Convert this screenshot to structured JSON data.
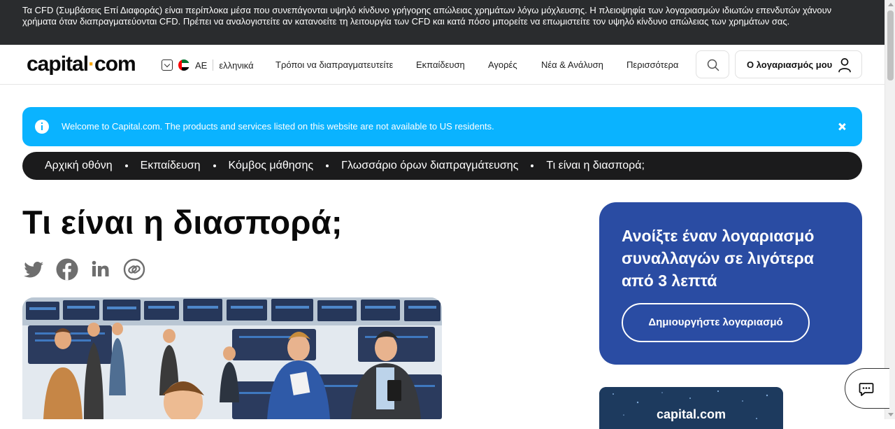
{
  "risk_warning": "Τα CFD (Συμβάσεις Επί Διαφοράς) είναι περίπλοκα μέσα που συνεπάγονται υψηλό κίνδυνο γρήγορης απώλειας χρημάτων λόγω μόχλευσης. Η πλειοψηφία των λογαριασμών ιδιωτών επενδυτών χάνουν χρήματα όταν διαπραγματεύονται CFD. Πρέπει να αναλογιστείτε αν κατανοείτε τη λειτουργία των CFD και κατά πόσο μπορείτε να επωμιστείτε τον υψηλό κίνδυνο απώλειας των χρημάτων σας.",
  "header": {
    "logo_left": "capital",
    "logo_right": "com",
    "region_code": "AE",
    "language": "ελληνικά",
    "nav": [
      "Τρόποι να διαπραγματευτείτε",
      "Εκπαίδευση",
      "Αγορές",
      "Νέα & Ανάλυση",
      "Περισσότερα"
    ],
    "account_label": "Ο λογαριασμός μου"
  },
  "welcome": {
    "message": "Welcome to Capital.com. The products and services listed on this website are not available to US residents."
  },
  "breadcrumb": [
    "Αρχική οθόνη",
    "Εκπαίδευση",
    "Κόμβος μάθησης",
    "Γλωσσάριο όρων διαπραγμάτευσης",
    "Τι είναι η διασπορά;"
  ],
  "article": {
    "title": "Τι είναι η διασπορά;",
    "share_icons": [
      "twitter-icon",
      "facebook-icon",
      "linkedin-icon",
      "copy-link-icon"
    ]
  },
  "promo": {
    "title": "Ανοίξτε έναν λογαριασμό συναλλαγών σε λιγότερα από 3 λεπτά",
    "cta": "Δημιουργήστε λογαριασμό"
  },
  "app_card": {
    "brand": "capital.com"
  },
  "colors": {
    "risk_bar_bg": "#2a2c2e",
    "welcome_bg": "#0ab3ff",
    "breadcrumb_bg": "#1b1b1c",
    "promo_bg": "#2a4ca3",
    "logo_accent": "#f7a501",
    "social_icon": "#6e6e6e"
  }
}
